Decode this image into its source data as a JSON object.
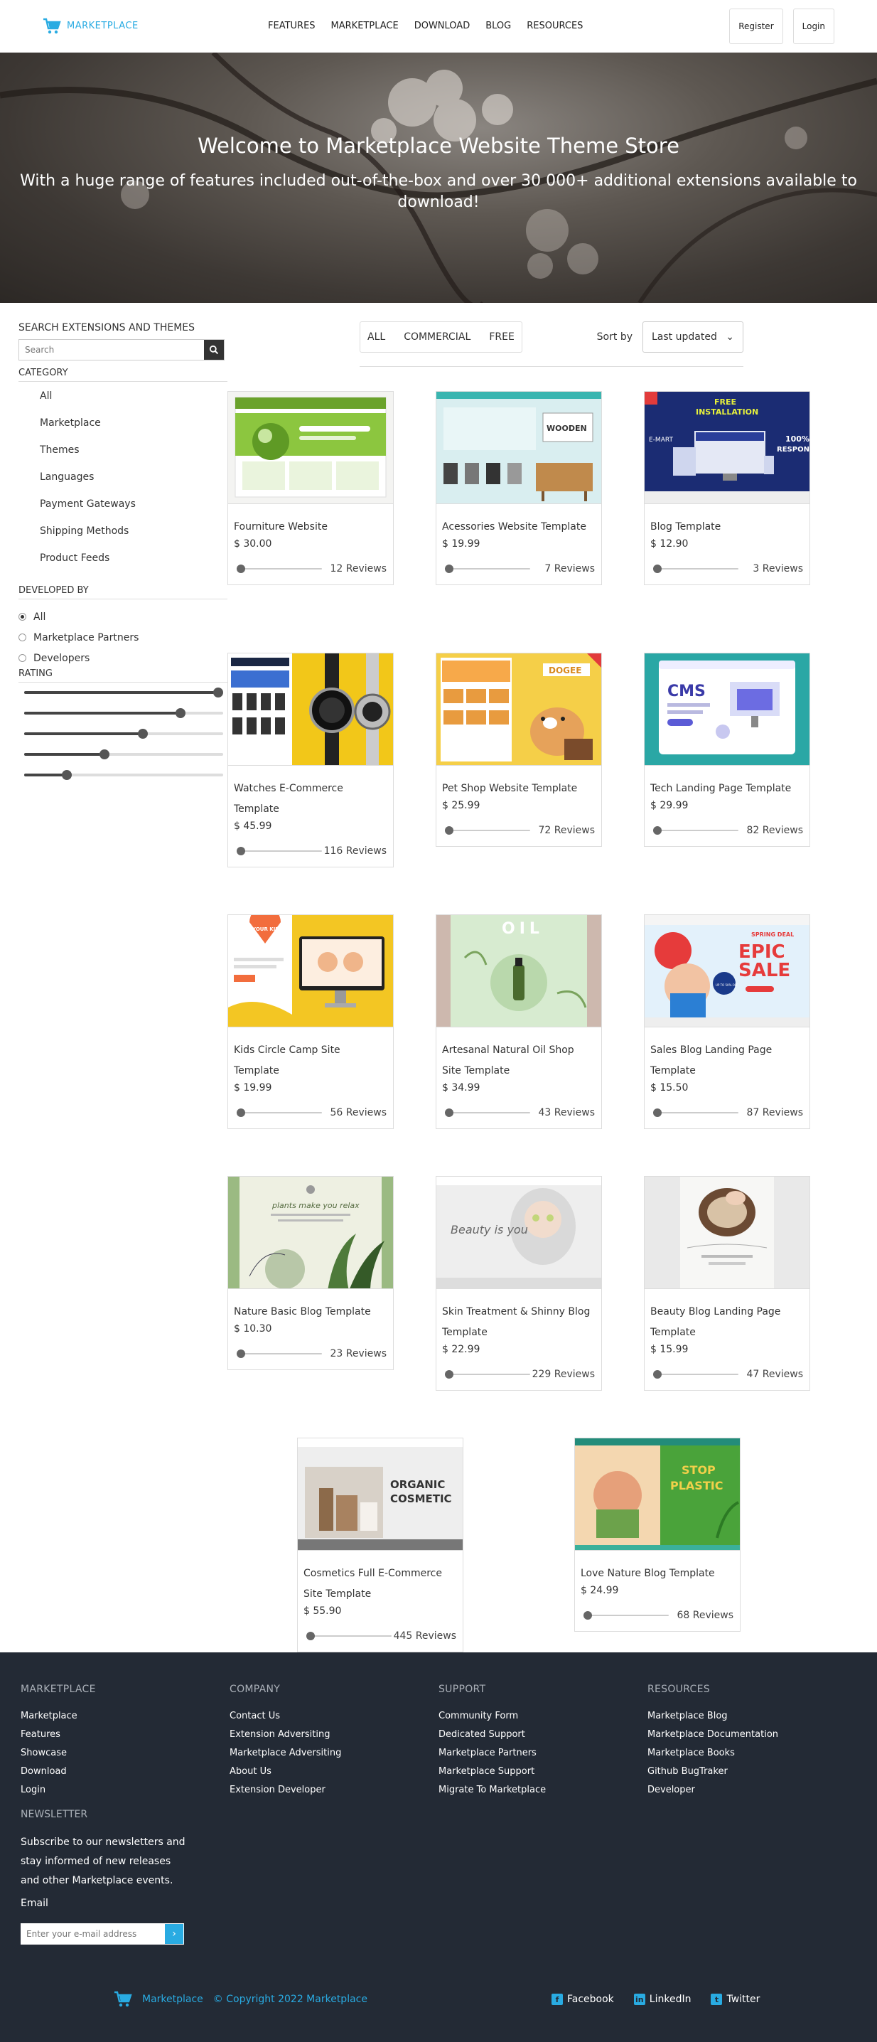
{
  "header": {
    "logo_text": "MARKETPLACE",
    "nav": [
      "FEATURES",
      "MARKETPLACE",
      "DOWNLOAD",
      "BLOG",
      "RESOURCES"
    ],
    "register_label": "Register",
    "login_label": "Login"
  },
  "hero": {
    "title": "Welcome to Marketplace Website Theme Store",
    "subtitle": "With a huge range of features included out-of-the-box and over 30 000+ additional extensions available to download!"
  },
  "sidebar": {
    "search_title": "SEARCH EXTENSIONS AND THEMES",
    "search_placeholder": "Search",
    "category_title": "CATEGORY",
    "categories": [
      "All",
      "Marketplace",
      "Themes",
      "Languages",
      "Payment Gateways",
      "Shipping Methods",
      "Product Feeds"
    ],
    "developed_title": "DEVELOPED BY",
    "developers": [
      {
        "label": "All",
        "selected": true
      },
      {
        "label": "Marketplace Partners",
        "selected": false
      },
      {
        "label": "Developers",
        "selected": false
      }
    ],
    "rating_title": "RATING",
    "rating_levels": [
      1.0,
      0.8,
      0.6,
      0.4,
      0.2
    ]
  },
  "toolbar": {
    "filters": [
      "ALL",
      "COMMERCIAL",
      "FREE"
    ],
    "sort_label": "Sort by",
    "sort_value": "Last updated"
  },
  "products": [
    {
      "name": "Fourniture Website",
      "price": "$ 30.00",
      "reviews": "12 Reviews",
      "thumb": "green"
    },
    {
      "name": "Acessories Website Template",
      "price": "$ 19.99",
      "reviews": "7 Reviews",
      "thumb": "wooden"
    },
    {
      "name": "Blog Template",
      "price": "$ 12.90",
      "reviews": "3 Reviews",
      "thumb": "install"
    },
    {
      "name": "Watches E-Commerce Template",
      "price": "$ 45.99",
      "reviews": "116 Reviews",
      "thumb": "watches"
    },
    {
      "name": "Pet Shop Website Template",
      "price": "$ 25.99",
      "reviews": "72 Reviews",
      "thumb": "pet"
    },
    {
      "name": "Tech Landing Page Template",
      "price": "$ 29.99",
      "reviews": "82 Reviews",
      "thumb": "cms"
    },
    {
      "name": "Kids Circle Camp Site Template",
      "price": "$ 19.99",
      "reviews": "56 Reviews",
      "thumb": "kids"
    },
    {
      "name": "Artesanal Natural Oil Shop Site Template",
      "price": "$ 34.99",
      "reviews": "43 Reviews",
      "thumb": "oil"
    },
    {
      "name": "Sales Blog Landing Page Template",
      "price": "$ 15.50",
      "reviews": "87 Reviews",
      "thumb": "sale"
    },
    {
      "name": "Nature Basic Blog Template",
      "price": "$ 10.30",
      "reviews": "23 Reviews",
      "thumb": "plants"
    },
    {
      "name": "Skin Treatment & Shinny Blog Template",
      "price": "$ 22.99",
      "reviews": "229 Reviews",
      "thumb": "beauty"
    },
    {
      "name": "Beauty Blog Landing Page Template",
      "price": "$ 15.99",
      "reviews": "47 Reviews",
      "thumb": "bowl"
    },
    {
      "name": "Cosmetics Full E-Commerce Site Template",
      "price": "$ 55.90",
      "reviews": "445 Reviews",
      "thumb": "organic"
    },
    {
      "name": "Love Nature Blog Template",
      "price": "$ 24.99",
      "reviews": "68 Reviews",
      "thumb": "plastic"
    }
  ],
  "thumb_text": {
    "wooden": "WOODEN",
    "install_line1": "FREE",
    "install_line2": "INSTALLATION",
    "install_side1": "100%",
    "install_side2": "RESPONS",
    "install_brand": "E-MART",
    "pet": "DOGEE",
    "cms": "CMS",
    "kids": "YOUR KIDS",
    "oil": "OIL",
    "sale_top": "SPRING DEAL",
    "sale_main1": "EPIC",
    "sale_main2": "SALE",
    "sale_badge": "UP TO 50% OFF",
    "plants": "plants make you relax",
    "beauty": "Beauty is you",
    "organic1": "ORGANIC",
    "organic2": "COSMETIC",
    "plastic1": "STOP",
    "plastic2": "PLASTIC"
  },
  "footer": {
    "columns": [
      {
        "title": "MARKETPLACE",
        "items": [
          "Marketplace",
          "Features",
          "Showcase",
          "Download",
          "Login"
        ]
      },
      {
        "title": "COMPANY",
        "items": [
          "Contact Us",
          "Extension Adversiting",
          "Marketplace Adversiting",
          "About Us",
          "Extension Developer"
        ]
      },
      {
        "title": "SUPPORT",
        "items": [
          "Community Form",
          "Dedicated Support",
          "Marketplace Partners",
          "Marketplace Support",
          "Migrate To Marketplace"
        ]
      },
      {
        "title": "RESOURCES",
        "items": [
          "Marketplace Blog",
          "Marketplace Documentation",
          "Marketplace Books",
          "Github BugTraker",
          "Developer"
        ]
      }
    ],
    "newsletter_title": "NEWSLETTER",
    "newsletter_text": "Subscribe to our newsletters and stay informed of new releases and other Marketplace events.",
    "email_label": "Email",
    "email_placeholder": "Enter your e-mail address",
    "brand": "Marketplace",
    "copyright": "© Copyright  2022  Marketplace",
    "social": [
      "Facebook",
      "LinkedIn",
      "Twitter"
    ]
  },
  "colors": {
    "accent": "#29abe2",
    "footer_bg": "#232a35"
  }
}
